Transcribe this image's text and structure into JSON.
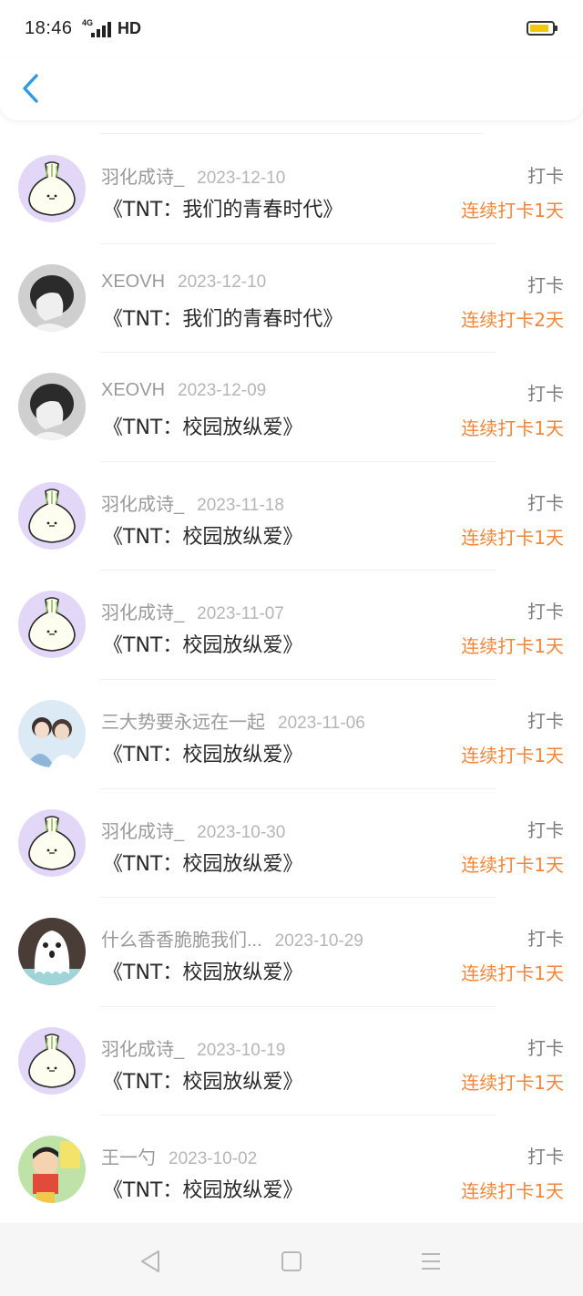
{
  "status_bar": {
    "time": "18:46",
    "network": "4G",
    "quality": "HD",
    "battery_level": 0.75,
    "battery_color": "#f5c70c"
  },
  "header": {
    "back_icon": "chevron-left-icon",
    "accent_color": "#2f9be4"
  },
  "entries": [
    {
      "user": "羽化成诗_",
      "date": "2023-12-10",
      "title": "《TNT：我们的青春时代》",
      "checkin": "打卡",
      "streak": "连续打卡1天",
      "avatar": "garlic-avatar"
    },
    {
      "user": "XEOVH",
      "date": "2023-12-10",
      "title": "《TNT：我们的青春时代》",
      "checkin": "打卡",
      "streak": "连续打卡2天",
      "avatar": "bw-photo-avatar"
    },
    {
      "user": "XEOVH",
      "date": "2023-12-09",
      "title": "《TNT：校园放纵爱》",
      "checkin": "打卡",
      "streak": "连续打卡1天",
      "avatar": "bw-photo-avatar"
    },
    {
      "user": "羽化成诗_",
      "date": "2023-11-18",
      "title": "《TNT：校园放纵爱》",
      "checkin": "打卡",
      "streak": "连续打卡1天",
      "avatar": "garlic-avatar"
    },
    {
      "user": "羽化成诗_",
      "date": "2023-11-07",
      "title": "《TNT：校园放纵爱》",
      "checkin": "打卡",
      "streak": "连续打卡1天",
      "avatar": "garlic-avatar"
    },
    {
      "user": "三大势要永远在一起",
      "date": "2023-11-06",
      "title": "《TNT：校园放纵爱》",
      "checkin": "打卡",
      "streak": "连续打卡1天",
      "avatar": "photo-avatar"
    },
    {
      "user": "羽化成诗_",
      "date": "2023-10-30",
      "title": "《TNT：校园放纵爱》",
      "checkin": "打卡",
      "streak": "连续打卡1天",
      "avatar": "garlic-avatar"
    },
    {
      "user": "什么香香脆脆我们...",
      "date": "2023-10-29",
      "title": "《TNT：校园放纵爱》",
      "checkin": "打卡",
      "streak": "连续打卡1天",
      "avatar": "ghost-avatar"
    },
    {
      "user": "羽化成诗_",
      "date": "2023-10-19",
      "title": "《TNT：校园放纵爱》",
      "checkin": "打卡",
      "streak": "连续打卡1天",
      "avatar": "garlic-avatar"
    },
    {
      "user": "王一勺",
      "date": "2023-10-02",
      "title": "《TNT：校园放纵爱》",
      "checkin": "打卡",
      "streak": "连续打卡1天",
      "avatar": "cartoon-avatar"
    }
  ],
  "colors": {
    "streak": "#f2863a",
    "checkin": "#7e7e7e",
    "garlic_bg": "#e3d7f7"
  },
  "bottom_nav": {
    "back": "triangle-back-icon",
    "home": "square-home-icon",
    "menu": "menu-lines-icon"
  }
}
